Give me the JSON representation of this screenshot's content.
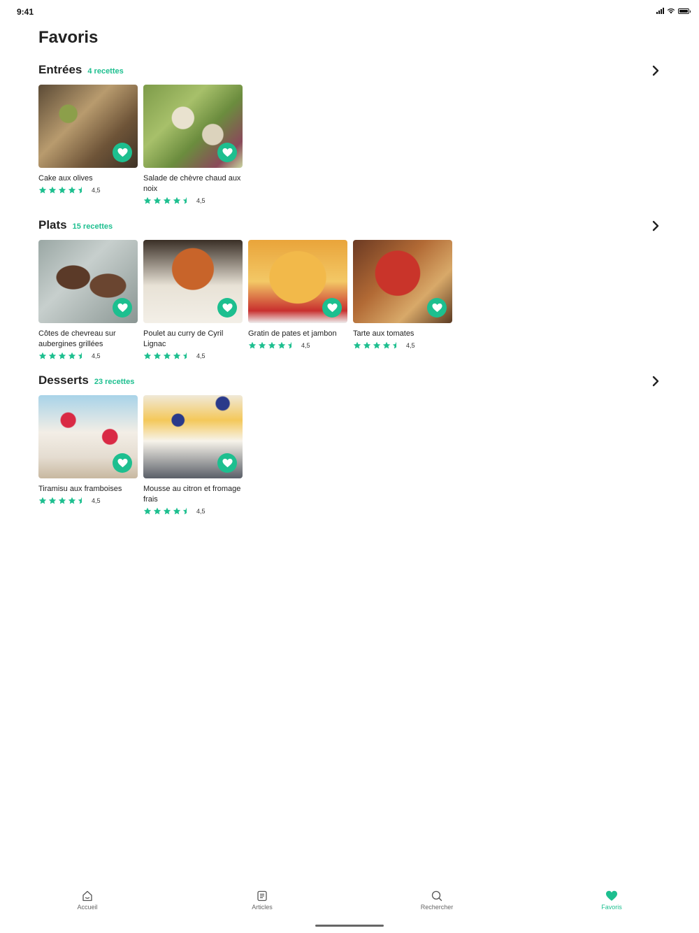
{
  "status_bar": {
    "time": "9:41"
  },
  "page": {
    "title": "Favoris"
  },
  "colors": {
    "accent": "#1dbf8f",
    "text": "#222222"
  },
  "sections": [
    {
      "title": "Entrées",
      "count": "4 recettes",
      "recipes": [
        {
          "title": "Cake aux olives",
          "rating": "4,5",
          "image": "cake-photo"
        },
        {
          "title": "Salade de chèvre chaud aux noix",
          "rating": "4,5",
          "image": "salad-photo"
        }
      ]
    },
    {
      "title": "Plats",
      "count": "15 recettes",
      "recipes": [
        {
          "title": "Côtes de chevreau sur aubergines grillées",
          "rating": "4,5",
          "image": "cotes-photo"
        },
        {
          "title": "Poulet au curry de Cyril Lignac",
          "rating": "4,5",
          "image": "curry-photo"
        },
        {
          "title": "Gratin de pates et jambon",
          "rating": "4,5",
          "image": "gratin-photo"
        },
        {
          "title": "Tarte aux tomates",
          "rating": "4,5",
          "image": "tarte-photo"
        }
      ]
    },
    {
      "title": "Desserts",
      "count": "23 recettes",
      "recipes": [
        {
          "title": "Tiramisu aux framboises",
          "rating": "4,5",
          "image": "tiramisu-photo"
        },
        {
          "title": "Mousse au citron et fromage frais",
          "rating": "4,5",
          "image": "mousse-photo"
        }
      ]
    }
  ],
  "tabbar": {
    "tabs": [
      {
        "label": "Accueil",
        "icon": "home-icon"
      },
      {
        "label": "Articles",
        "icon": "articles-icon"
      },
      {
        "label": "Rechercher",
        "icon": "search-icon"
      },
      {
        "label": "Favoris",
        "icon": "heart-icon"
      }
    ],
    "active_tab": "Favoris"
  }
}
